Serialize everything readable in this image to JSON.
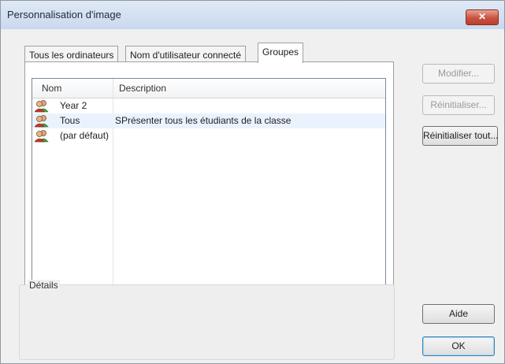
{
  "window": {
    "title": "Personnalisation d'image",
    "close_glyph": "✕"
  },
  "tabs": [
    {
      "label": "Tous les ordinateurs",
      "active": false
    },
    {
      "label": "Nom d'utilisateur connecté",
      "active": false
    },
    {
      "label": "Groupes",
      "active": true
    }
  ],
  "list": {
    "columns": [
      "Nom",
      "Description"
    ],
    "rows": [
      {
        "name": "Year 2",
        "description": "",
        "icon": "group-icon"
      },
      {
        "name": "Tous",
        "description": "SPrésenter tous les étudiants de la classe",
        "icon": "group-icon",
        "selected": true
      },
      {
        "name": "(par défaut)",
        "description": "",
        "icon": "group-icon"
      }
    ]
  },
  "details": {
    "label": "Détails"
  },
  "buttons": {
    "modify": "Modifier...",
    "reset": "Réinitialiser...",
    "reset_all": "Réinitialiser tout...",
    "help": "Aide",
    "ok": "OK"
  },
  "colors": {
    "selection": "#eaf3fd",
    "close_button": "#c9523f",
    "titlebar": "#dfe9f5"
  }
}
